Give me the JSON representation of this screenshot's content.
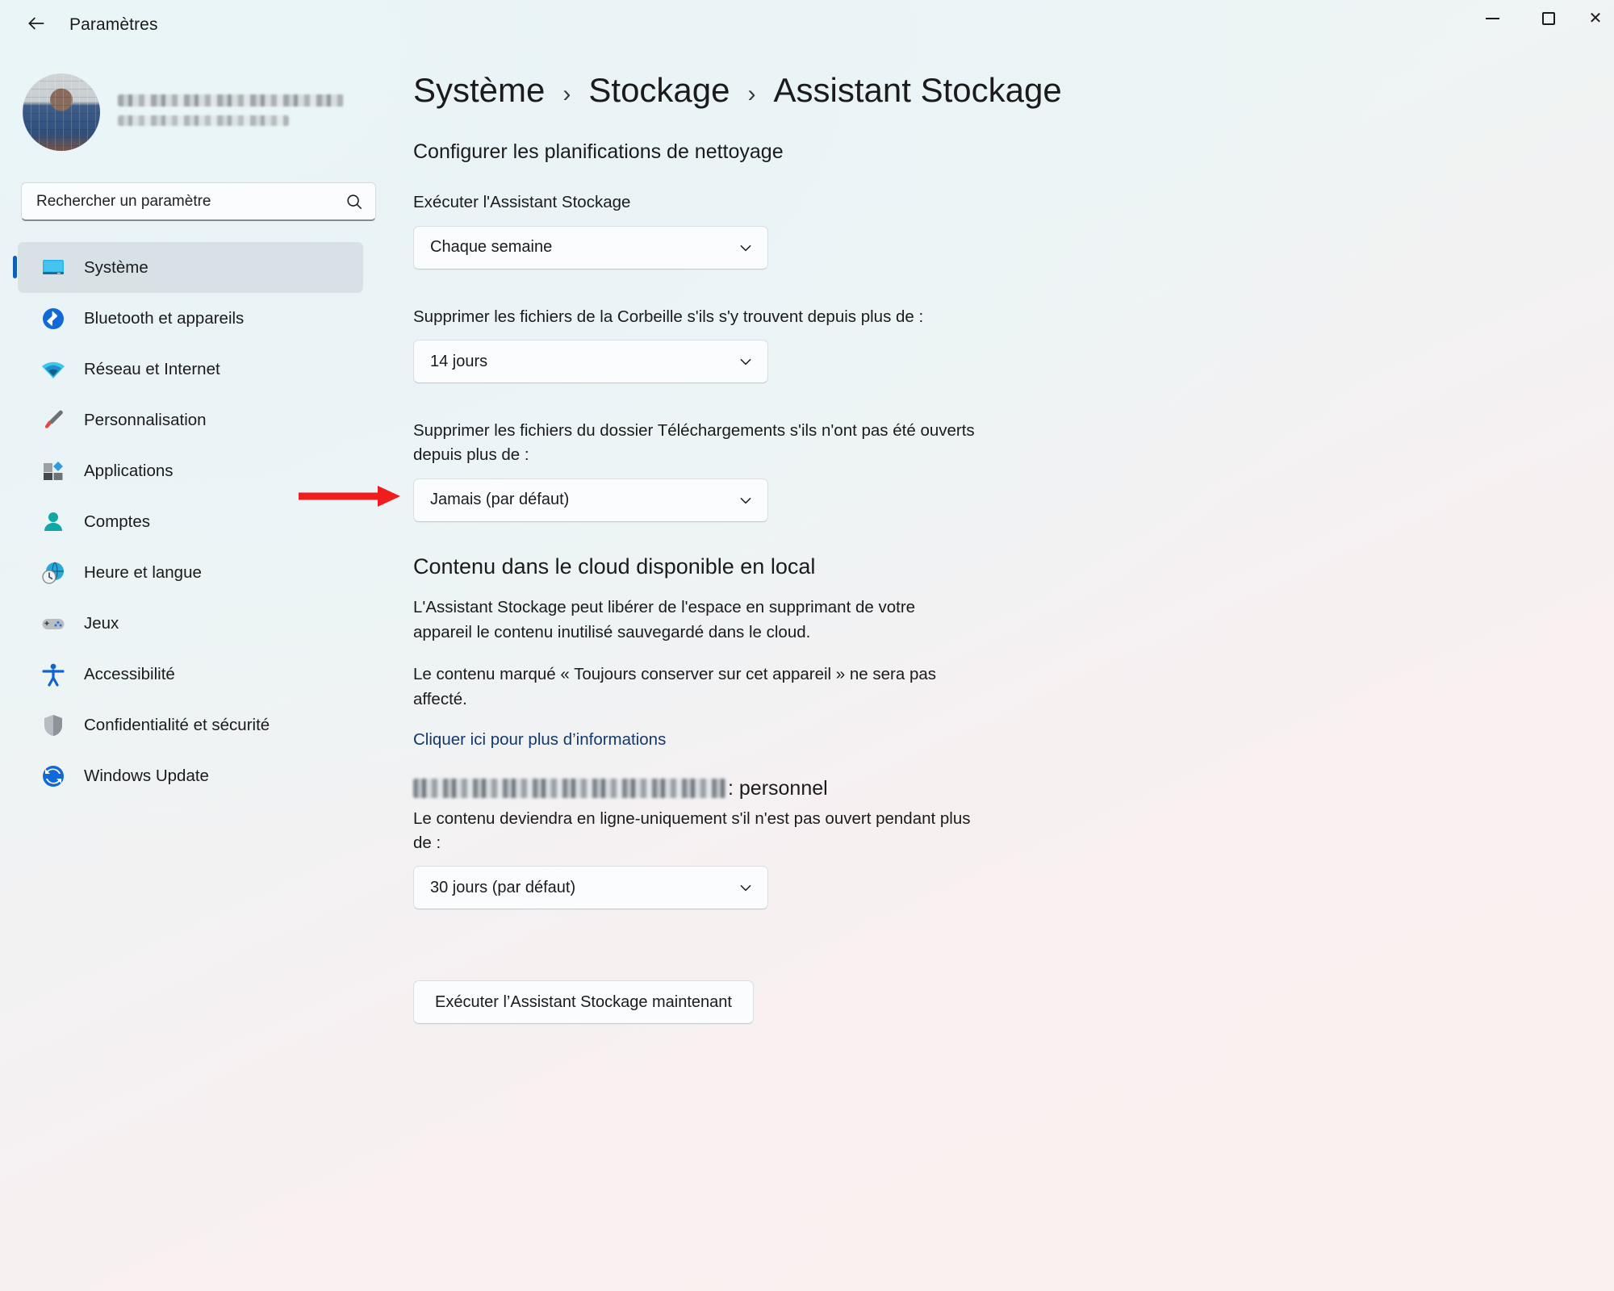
{
  "titlebar": {
    "app_title": "Paramètres",
    "back_icon": "arrow-left-icon",
    "minimize_label": "—",
    "maximize_label": "□",
    "close_label": "✕"
  },
  "sidebar": {
    "account": {
      "name_redacted": "",
      "email_redacted": ""
    },
    "search": {
      "placeholder": "Rechercher un paramètre",
      "value": ""
    },
    "items": [
      {
        "label": "Système",
        "icon": "monitor-icon",
        "selected": true
      },
      {
        "label": "Bluetooth et appareils",
        "icon": "bluetooth-icon",
        "selected": false
      },
      {
        "label": "Réseau et Internet",
        "icon": "wifi-icon",
        "selected": false
      },
      {
        "label": "Personnalisation",
        "icon": "paintbrush-icon",
        "selected": false
      },
      {
        "label": "Applications",
        "icon": "apps-icon",
        "selected": false
      },
      {
        "label": "Comptes",
        "icon": "person-icon",
        "selected": false
      },
      {
        "label": "Heure et langue",
        "icon": "globe-clock-icon",
        "selected": false
      },
      {
        "label": "Jeux",
        "icon": "gamepad-icon",
        "selected": false
      },
      {
        "label": "Accessibilité",
        "icon": "accessibility-icon",
        "selected": false
      },
      {
        "label": "Confidentialité et sécurité",
        "icon": "shield-icon",
        "selected": false
      },
      {
        "label": "Windows Update",
        "icon": "update-icon",
        "selected": false
      }
    ]
  },
  "main": {
    "breadcrumb": {
      "item1": "Système",
      "separator1": "›",
      "item2": "Stockage",
      "separator2": "›",
      "item3": "Assistant Stockage"
    },
    "schedule_section": {
      "title": "Configurer les planifications de nettoyage",
      "run_assistant": {
        "label": "Exécuter l'Assistant Stockage",
        "value": "Chaque semaine"
      },
      "recycle_bin": {
        "label": "Supprimer les fichiers de la Corbeille s'ils s'y trouvent depuis plus de :",
        "value": "14 jours"
      },
      "downloads": {
        "label": "Supprimer les fichiers du dossier Téléchargements s'ils n'ont pas été ouverts depuis plus de :",
        "value": "Jamais (par défaut)"
      }
    },
    "cloud_section": {
      "heading": "Contenu dans le cloud disponible en local",
      "paragraph1": "L'Assistant Stockage peut libérer de l'espace en supprimant de votre appareil le contenu inutilisé sauvegardé dans le cloud.",
      "paragraph2": "Le contenu marqué « Toujours conserver sur cet appareil » ne sera pas affecté.",
      "link": "Cliquer ici pour plus d’informations",
      "account_suffix": ": personnel",
      "online_only": {
        "label": "Le contenu deviendra en ligne-uniquement s'il n'est pas ouvert pendant plus de :",
        "value": "30 jours (par défaut)"
      }
    },
    "run_now_button": "Exécuter l’Assistant Stockage maintenant"
  },
  "annotation": {
    "arrow_color": "#f01d1d",
    "points_to": "Jamais (par défaut)"
  }
}
